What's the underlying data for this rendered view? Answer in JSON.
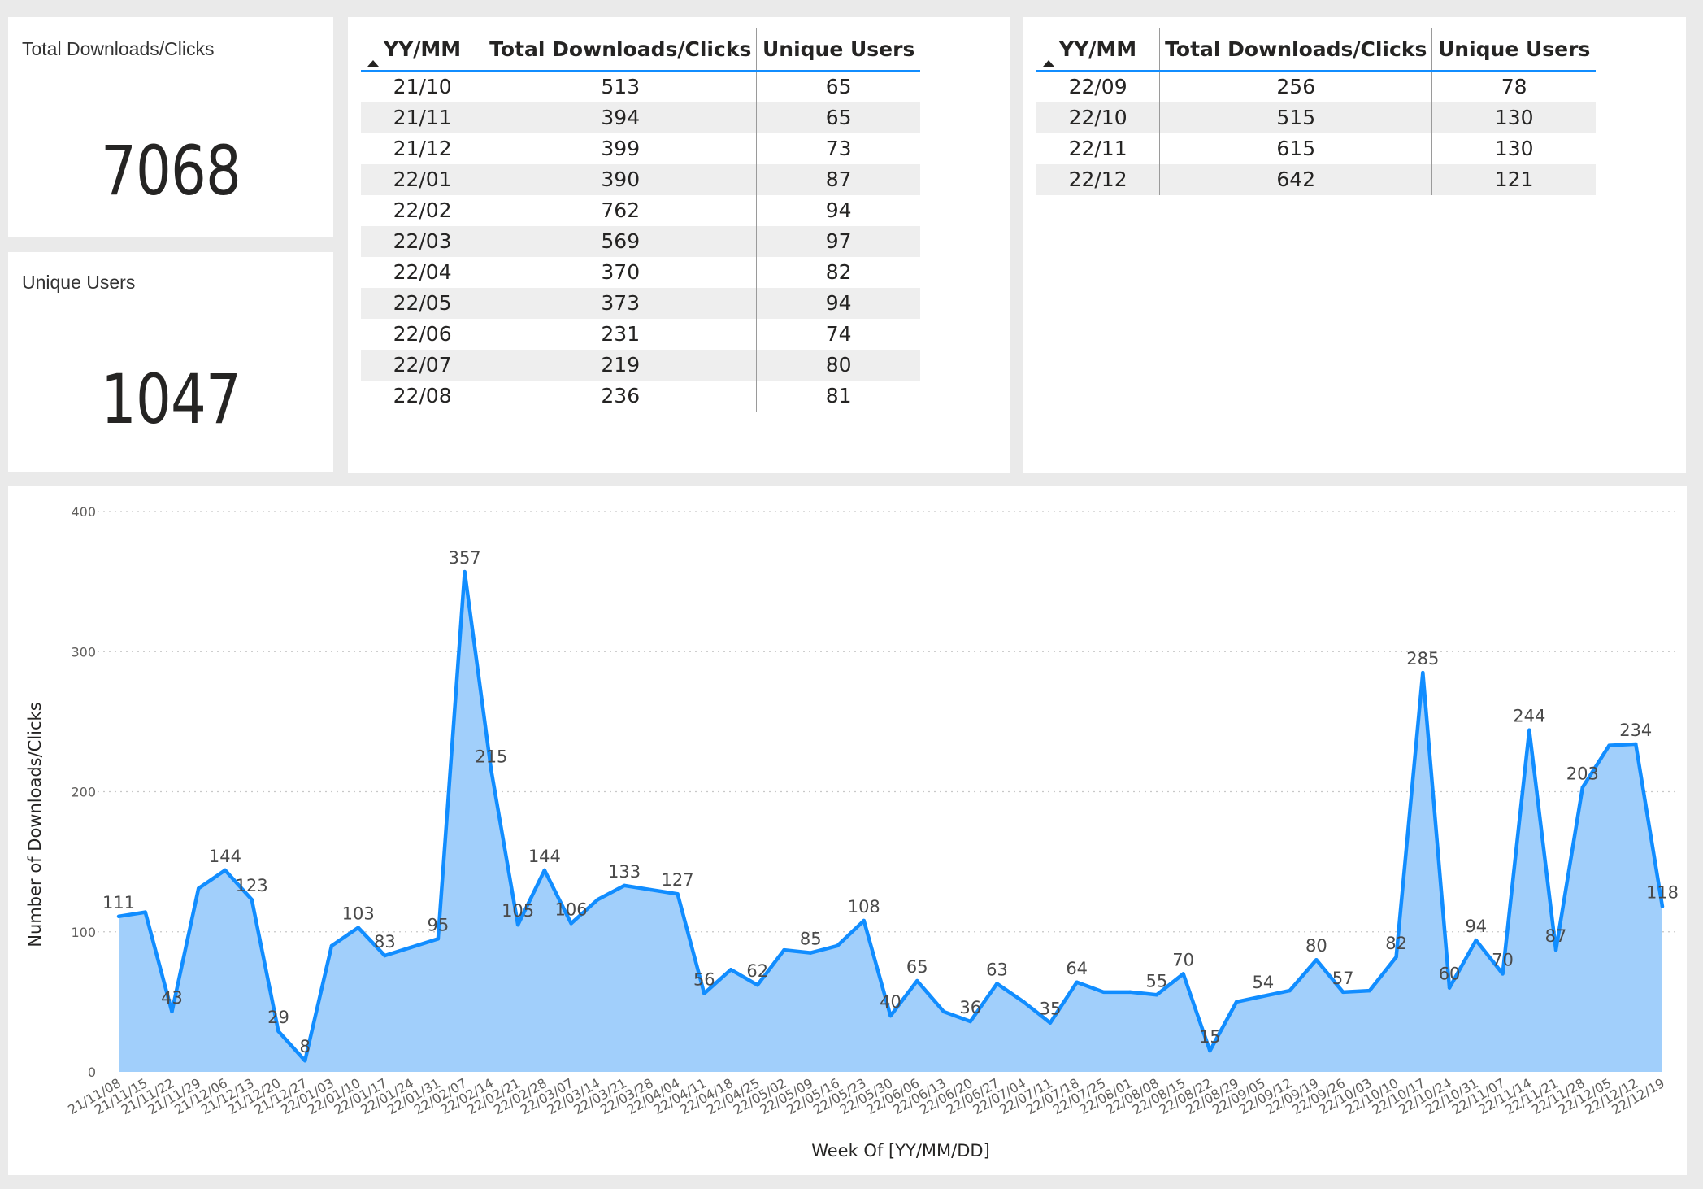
{
  "kpis": {
    "total": {
      "title": "Total Downloads/Clicks",
      "value": "7068"
    },
    "unique": {
      "title": "Unique Users",
      "value": "1047"
    }
  },
  "table_left": {
    "headers": [
      "YY/MM",
      "Total Downloads/Clicks",
      "Unique Users"
    ],
    "rows": [
      [
        "21/10",
        "513",
        "65"
      ],
      [
        "21/11",
        "394",
        "65"
      ],
      [
        "21/12",
        "399",
        "73"
      ],
      [
        "22/01",
        "390",
        "87"
      ],
      [
        "22/02",
        "762",
        "94"
      ],
      [
        "22/03",
        "569",
        "97"
      ],
      [
        "22/04",
        "370",
        "82"
      ],
      [
        "22/05",
        "373",
        "94"
      ],
      [
        "22/06",
        "231",
        "74"
      ],
      [
        "22/07",
        "219",
        "80"
      ],
      [
        "22/08",
        "236",
        "81"
      ]
    ]
  },
  "table_right": {
    "headers": [
      "YY/MM",
      "Total Downloads/Clicks",
      "Unique Users"
    ],
    "rows": [
      [
        "22/09",
        "256",
        "78"
      ],
      [
        "22/10",
        "515",
        "130"
      ],
      [
        "22/11",
        "615",
        "130"
      ],
      [
        "22/12",
        "642",
        "121"
      ]
    ]
  },
  "colors": {
    "line": "#118dff",
    "area": "#a1cffb",
    "background": "#eaeaea"
  },
  "chart_data": {
    "type": "area",
    "xlabel": "Week Of [YY/MM/DD]",
    "ylabel": "Number of Downloads/Clicks",
    "ylim": [
      0,
      400
    ],
    "yticks": [
      0,
      100,
      200,
      300,
      400
    ],
    "grid": true,
    "x": [
      "21/11/08",
      "21/11/15",
      "21/11/22",
      "21/11/29",
      "21/12/06",
      "21/12/13",
      "21/12/20",
      "21/12/27",
      "22/01/03",
      "22/01/10",
      "22/01/17",
      "22/01/24",
      "22/01/31",
      "22/02/07",
      "22/02/14",
      "22/02/21",
      "22/02/28",
      "22/03/07",
      "22/03/14",
      "22/03/21",
      "22/03/28",
      "22/04/04",
      "22/04/11",
      "22/04/18",
      "22/04/25",
      "22/05/02",
      "22/05/09",
      "22/05/16",
      "22/05/23",
      "22/05/30",
      "22/06/06",
      "22/06/13",
      "22/06/20",
      "22/06/27",
      "22/07/04",
      "22/07/11",
      "22/07/18",
      "22/07/25",
      "22/08/01",
      "22/08/08",
      "22/08/15",
      "22/08/22",
      "22/08/29",
      "22/09/05",
      "22/09/12",
      "22/09/19",
      "22/09/26",
      "22/10/03",
      "22/10/10",
      "22/10/17",
      "22/10/24",
      "22/10/31",
      "22/11/07",
      "22/11/14",
      "22/11/21",
      "22/11/28",
      "22/12/05",
      "22/12/12",
      "22/12/19"
    ],
    "series": [
      {
        "values": [
          111,
          114,
          43,
          131,
          144,
          123,
          29,
          8,
          90,
          103,
          83,
          89,
          95,
          357,
          215,
          105,
          144,
          106,
          123,
          133,
          130,
          127,
          56,
          73,
          62,
          87,
          85,
          90,
          108,
          40,
          65,
          43,
          36,
          63,
          50,
          35,
          64,
          57,
          57,
          55,
          70,
          15,
          50,
          54,
          58,
          80,
          57,
          58,
          82,
          285,
          60,
          94,
          70,
          244,
          87,
          203,
          233,
          234,
          118
        ]
      }
    ],
    "labels": [
      {
        "i": 0,
        "text": "111"
      },
      {
        "i": 2,
        "text": "43"
      },
      {
        "i": 4,
        "text": "144"
      },
      {
        "i": 5,
        "text": "123"
      },
      {
        "i": 6,
        "text": "29"
      },
      {
        "i": 7,
        "text": "8"
      },
      {
        "i": 9,
        "text": "103"
      },
      {
        "i": 10,
        "text": "83"
      },
      {
        "i": 12,
        "text": "95"
      },
      {
        "i": 13,
        "text": "357"
      },
      {
        "i": 14,
        "text": "215"
      },
      {
        "i": 15,
        "text": "105"
      },
      {
        "i": 16,
        "text": "144"
      },
      {
        "i": 17,
        "text": "106"
      },
      {
        "i": 19,
        "text": "133"
      },
      {
        "i": 21,
        "text": "127"
      },
      {
        "i": 22,
        "text": "56"
      },
      {
        "i": 24,
        "text": "62"
      },
      {
        "i": 26,
        "text": "85"
      },
      {
        "i": 28,
        "text": "108"
      },
      {
        "i": 29,
        "text": "40"
      },
      {
        "i": 30,
        "text": "65"
      },
      {
        "i": 32,
        "text": "36"
      },
      {
        "i": 33,
        "text": "63"
      },
      {
        "i": 35,
        "text": "35"
      },
      {
        "i": 36,
        "text": "64"
      },
      {
        "i": 39,
        "text": "55"
      },
      {
        "i": 40,
        "text": "70"
      },
      {
        "i": 41,
        "text": "15"
      },
      {
        "i": 43,
        "text": "54"
      },
      {
        "i": 45,
        "text": "80"
      },
      {
        "i": 46,
        "text": "57"
      },
      {
        "i": 48,
        "text": "82"
      },
      {
        "i": 49,
        "text": "285"
      },
      {
        "i": 50,
        "text": "60"
      },
      {
        "i": 51,
        "text": "94"
      },
      {
        "i": 52,
        "text": "70"
      },
      {
        "i": 53,
        "text": "244"
      },
      {
        "i": 54,
        "text": "87"
      },
      {
        "i": 55,
        "text": "203"
      },
      {
        "i": 57,
        "text": "234"
      },
      {
        "i": 58,
        "text": "118"
      }
    ]
  }
}
